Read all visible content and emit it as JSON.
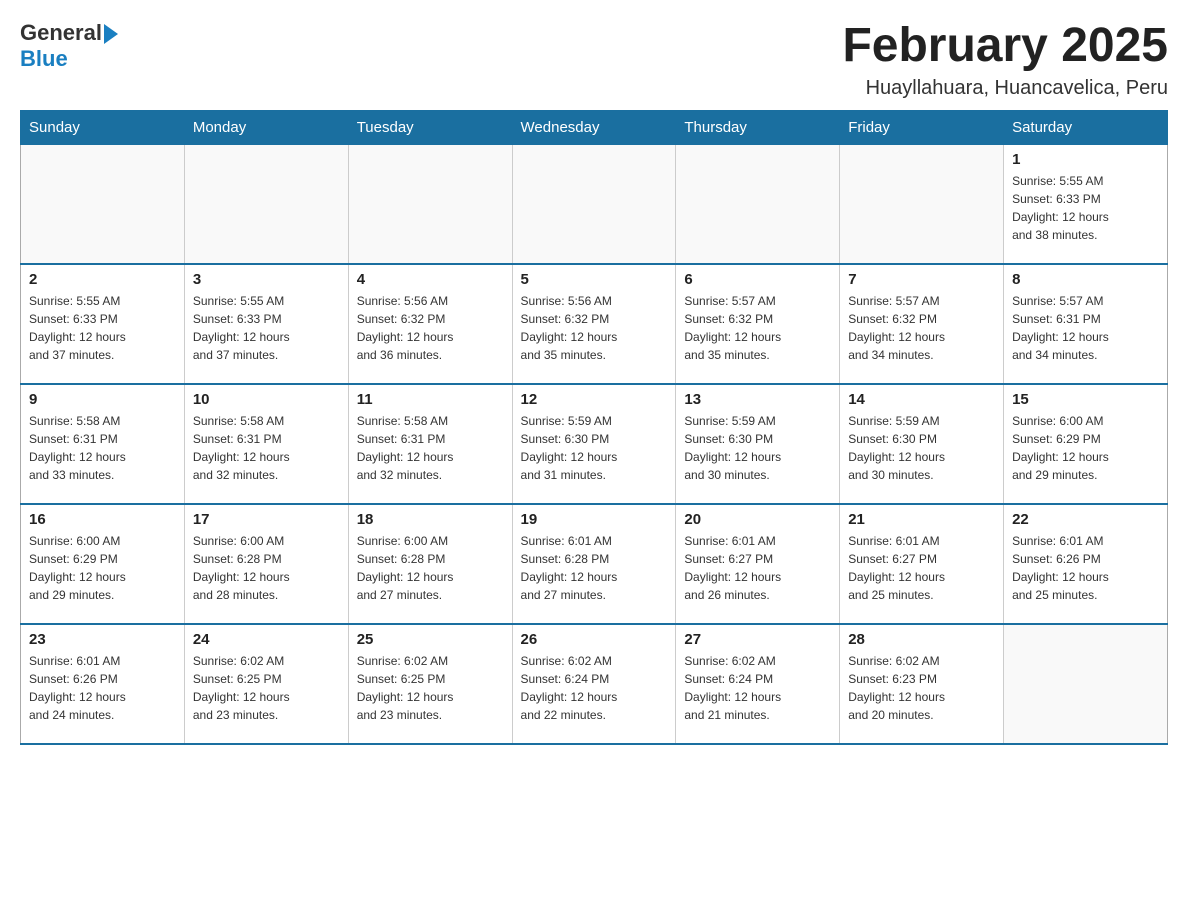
{
  "logo": {
    "general": "General",
    "blue": "Blue"
  },
  "title": "February 2025",
  "location": "Huayllahuara, Huancavelica, Peru",
  "weekdays": [
    "Sunday",
    "Monday",
    "Tuesday",
    "Wednesday",
    "Thursday",
    "Friday",
    "Saturday"
  ],
  "weeks": [
    [
      {
        "day": "",
        "info": ""
      },
      {
        "day": "",
        "info": ""
      },
      {
        "day": "",
        "info": ""
      },
      {
        "day": "",
        "info": ""
      },
      {
        "day": "",
        "info": ""
      },
      {
        "day": "",
        "info": ""
      },
      {
        "day": "1",
        "info": "Sunrise: 5:55 AM\nSunset: 6:33 PM\nDaylight: 12 hours\nand 38 minutes."
      }
    ],
    [
      {
        "day": "2",
        "info": "Sunrise: 5:55 AM\nSunset: 6:33 PM\nDaylight: 12 hours\nand 37 minutes."
      },
      {
        "day": "3",
        "info": "Sunrise: 5:55 AM\nSunset: 6:33 PM\nDaylight: 12 hours\nand 37 minutes."
      },
      {
        "day": "4",
        "info": "Sunrise: 5:56 AM\nSunset: 6:32 PM\nDaylight: 12 hours\nand 36 minutes."
      },
      {
        "day": "5",
        "info": "Sunrise: 5:56 AM\nSunset: 6:32 PM\nDaylight: 12 hours\nand 35 minutes."
      },
      {
        "day": "6",
        "info": "Sunrise: 5:57 AM\nSunset: 6:32 PM\nDaylight: 12 hours\nand 35 minutes."
      },
      {
        "day": "7",
        "info": "Sunrise: 5:57 AM\nSunset: 6:32 PM\nDaylight: 12 hours\nand 34 minutes."
      },
      {
        "day": "8",
        "info": "Sunrise: 5:57 AM\nSunset: 6:31 PM\nDaylight: 12 hours\nand 34 minutes."
      }
    ],
    [
      {
        "day": "9",
        "info": "Sunrise: 5:58 AM\nSunset: 6:31 PM\nDaylight: 12 hours\nand 33 minutes."
      },
      {
        "day": "10",
        "info": "Sunrise: 5:58 AM\nSunset: 6:31 PM\nDaylight: 12 hours\nand 32 minutes."
      },
      {
        "day": "11",
        "info": "Sunrise: 5:58 AM\nSunset: 6:31 PM\nDaylight: 12 hours\nand 32 minutes."
      },
      {
        "day": "12",
        "info": "Sunrise: 5:59 AM\nSunset: 6:30 PM\nDaylight: 12 hours\nand 31 minutes."
      },
      {
        "day": "13",
        "info": "Sunrise: 5:59 AM\nSunset: 6:30 PM\nDaylight: 12 hours\nand 30 minutes."
      },
      {
        "day": "14",
        "info": "Sunrise: 5:59 AM\nSunset: 6:30 PM\nDaylight: 12 hours\nand 30 minutes."
      },
      {
        "day": "15",
        "info": "Sunrise: 6:00 AM\nSunset: 6:29 PM\nDaylight: 12 hours\nand 29 minutes."
      }
    ],
    [
      {
        "day": "16",
        "info": "Sunrise: 6:00 AM\nSunset: 6:29 PM\nDaylight: 12 hours\nand 29 minutes."
      },
      {
        "day": "17",
        "info": "Sunrise: 6:00 AM\nSunset: 6:28 PM\nDaylight: 12 hours\nand 28 minutes."
      },
      {
        "day": "18",
        "info": "Sunrise: 6:00 AM\nSunset: 6:28 PM\nDaylight: 12 hours\nand 27 minutes."
      },
      {
        "day": "19",
        "info": "Sunrise: 6:01 AM\nSunset: 6:28 PM\nDaylight: 12 hours\nand 27 minutes."
      },
      {
        "day": "20",
        "info": "Sunrise: 6:01 AM\nSunset: 6:27 PM\nDaylight: 12 hours\nand 26 minutes."
      },
      {
        "day": "21",
        "info": "Sunrise: 6:01 AM\nSunset: 6:27 PM\nDaylight: 12 hours\nand 25 minutes."
      },
      {
        "day": "22",
        "info": "Sunrise: 6:01 AM\nSunset: 6:26 PM\nDaylight: 12 hours\nand 25 minutes."
      }
    ],
    [
      {
        "day": "23",
        "info": "Sunrise: 6:01 AM\nSunset: 6:26 PM\nDaylight: 12 hours\nand 24 minutes."
      },
      {
        "day": "24",
        "info": "Sunrise: 6:02 AM\nSunset: 6:25 PM\nDaylight: 12 hours\nand 23 minutes."
      },
      {
        "day": "25",
        "info": "Sunrise: 6:02 AM\nSunset: 6:25 PM\nDaylight: 12 hours\nand 23 minutes."
      },
      {
        "day": "26",
        "info": "Sunrise: 6:02 AM\nSunset: 6:24 PM\nDaylight: 12 hours\nand 22 minutes."
      },
      {
        "day": "27",
        "info": "Sunrise: 6:02 AM\nSunset: 6:24 PM\nDaylight: 12 hours\nand 21 minutes."
      },
      {
        "day": "28",
        "info": "Sunrise: 6:02 AM\nSunset: 6:23 PM\nDaylight: 12 hours\nand 20 minutes."
      },
      {
        "day": "",
        "info": ""
      }
    ]
  ]
}
